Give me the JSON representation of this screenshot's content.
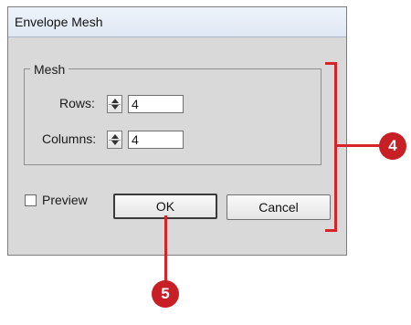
{
  "dialog": {
    "title": "Envelope Mesh",
    "group_label": "Mesh",
    "rows_label": "Rows:",
    "rows_value": "4",
    "columns_label": "Columns:",
    "columns_value": "4",
    "preview_label": "Preview",
    "preview_checked": false,
    "ok_label": "OK",
    "cancel_label": "Cancel"
  },
  "callouts": {
    "step_4": "4",
    "step_5": "5",
    "color": "#d7242b"
  }
}
